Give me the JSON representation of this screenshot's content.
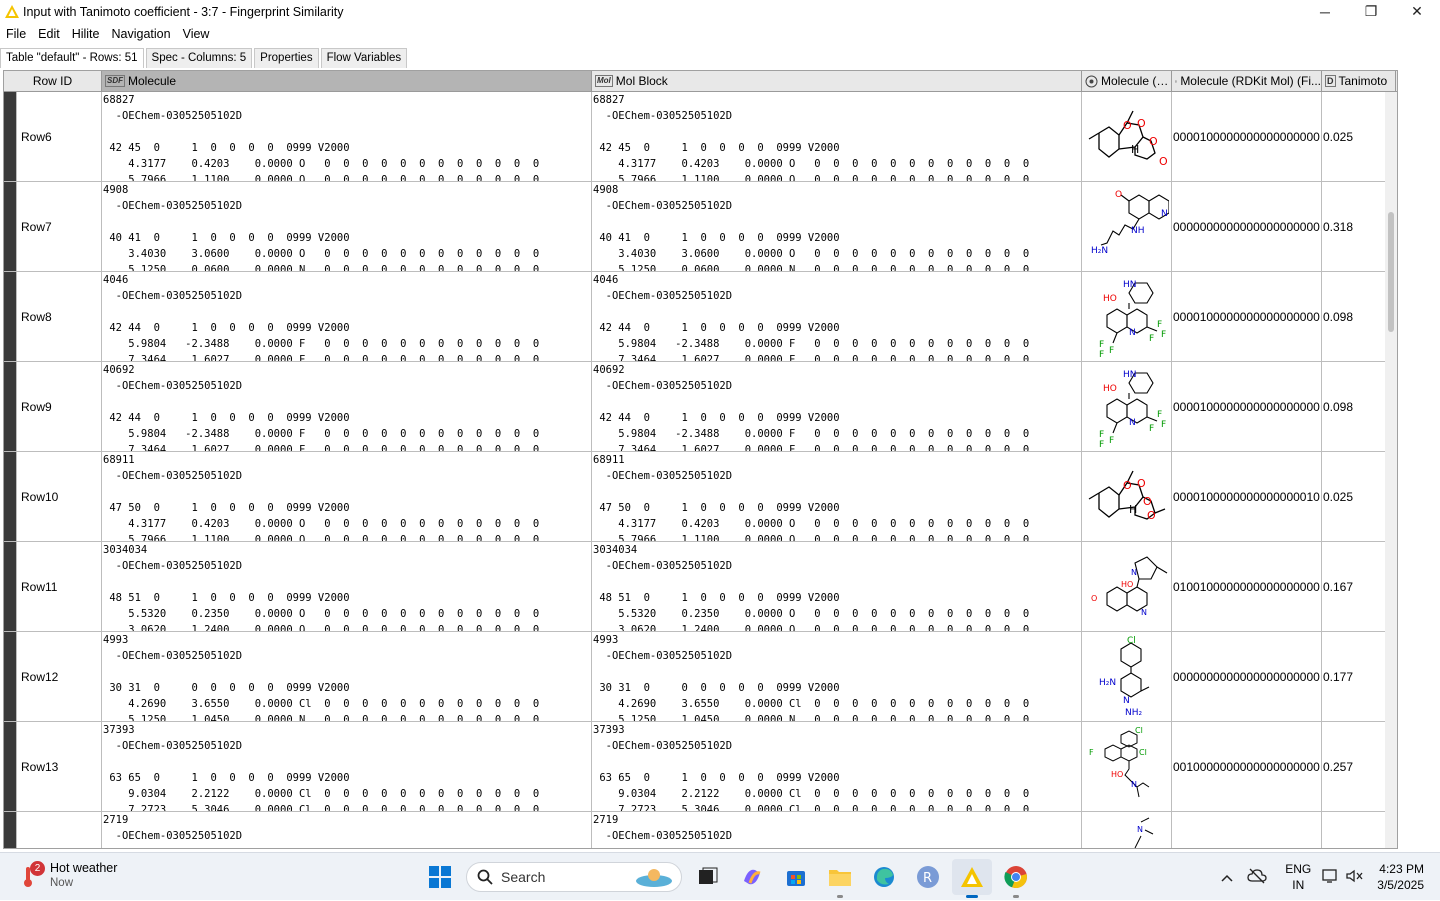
{
  "window": {
    "title": "Input with Tanimoto coefficient - 3:7 - Fingerprint Similarity",
    "minimize": "─",
    "maximize": "❐",
    "close": "✕"
  },
  "menu": [
    "File",
    "Edit",
    "Hilite",
    "Navigation",
    "View"
  ],
  "tabs": [
    "Table \"default\" - Rows: 51",
    "Spec - Columns: 5",
    "Properties",
    "Flow Variables"
  ],
  "table": {
    "headers": {
      "rowid": "Row ID",
      "molecule": "Molecule",
      "molblock": "Mol Block",
      "mol_img": "Molecule (…",
      "rdkit_fp": "Molecule (RDKit Mol) (Fi...",
      "tanimoto": "Tanimoto"
    },
    "header_type_icons": {
      "molecule": "SDF",
      "molblock": "Mol",
      "tanimoto": "D"
    },
    "rows": [
      {
        "id": "Row6",
        "mol": "68827\n  -OEChem-03052505102D\n\n 42 45  0     1  0  0  0  0  0999 V2000\n    4.3177    0.4203    0.0000 O   0  0  0  0  0  0  0  0  0  0  0  0\n    5.7966    1.1100    0.0000 O   0  0  0  0  0  0  0  0  0  0  0  0",
        "fp": "0000100000000000000000...",
        "tanimoto": "0.025"
      },
      {
        "id": "Row7",
        "mol": "4908\n  -OEChem-03052505102D\n\n 40 41  0     1  0  0  0  0  0999 V2000\n    3.4030    3.0600    0.0000 O   0  0  0  0  0  0  0  0  0  0  0  0\n    5.1250    0.0600    0.0000 N   0  0  0  0  0  0  0  0  0  0  0  0",
        "fp": "0000000000000000000000...",
        "tanimoto": "0.318"
      },
      {
        "id": "Row8",
        "mol": "4046\n  -OEChem-03052505102D\n\n 42 44  0     1  0  0  0  0  0999 V2000\n    5.9804   -2.3488    0.0000 F   0  0  0  0  0  0  0  0  0  0  0  0\n    7.3464    1.6027    0.0000 F   0  0  0  0  0  0  0  0  0  0  0  0",
        "fp": "0000100000000000000000...",
        "tanimoto": "0.098"
      },
      {
        "id": "Row9",
        "mol": "40692\n  -OEChem-03052505102D\n\n 42 44  0     1  0  0  0  0  0999 V2000\n    5.9804   -2.3488    0.0000 F   0  0  0  0  0  0  0  0  0  0  0  0\n    7.3464    1.6027    0.0000 F   0  0  0  0  0  0  0  0  0  0  0  0",
        "fp": "0000100000000000000000...",
        "tanimoto": "0.098"
      },
      {
        "id": "Row10",
        "mol": "68911\n  -OEChem-03052505102D\n\n 47 50  0     1  0  0  0  0  0999 V2000\n    4.3177    0.4203    0.0000 O   0  0  0  0  0  0  0  0  0  0  0  0\n    5.7966    1.1100    0.0000 O   0  0  0  0  0  0  0  0  0  0  0  0",
        "fp": "0000100000000000000010...",
        "tanimoto": "0.025"
      },
      {
        "id": "Row11",
        "mol": "3034034\n  -OEChem-03052505102D\n\n 48 51  0     1  0  0  0  0  0999 V2000\n    5.5320    0.2350    0.0000 O   0  0  0  0  0  0  0  0  0  0  0  0\n    3.0620    1.2400    0.0000 O   0  0  0  0  0  0  0  0  0  0  0  0",
        "fp": "0100100000000000000000...",
        "tanimoto": "0.167"
      },
      {
        "id": "Row12",
        "mol": "4993\n  -OEChem-03052505102D\n\n 30 31  0     0  0  0  0  0  0999 V2000\n    4.2690    3.6550    0.0000 Cl  0  0  0  0  0  0  0  0  0  0  0  0\n    5.1250    1.0450    0.0000 N   0  0  0  0  0  0  0  0  0  0  0  0",
        "fp": "0000000000000000000000...",
        "tanimoto": "0.177"
      },
      {
        "id": "Row13",
        "mol": "37393\n  -OEChem-03052505102D\n\n 63 65  0     1  0  0  0  0  0999 V2000\n    9.0304    2.2122    0.0000 Cl  0  0  0  0  0  0  0  0  0  0  0  0\n    7.2723    5.3046    0.0000 Cl  0  0  0  0  0  0  0  0  0  0  0  0",
        "fp": "0010000000000000000000...",
        "tanimoto": "0.257"
      },
      {
        "id": "",
        "mol": "2719\n  -OEChem-03052505102D",
        "fp": "",
        "tanimoto": ""
      }
    ]
  },
  "taskbar": {
    "weather_title": "Hot weather",
    "weather_sub": "Now",
    "notification_count": "2",
    "search_placeholder": "Search",
    "lang_top": "ENG",
    "lang_bottom": "IN",
    "time": "4:23 PM",
    "date": "3/5/2025"
  },
  "colors": {
    "accent": "#0067c0",
    "header_bg": "#e8e8e8",
    "row_selector": "#3a3a3a"
  }
}
